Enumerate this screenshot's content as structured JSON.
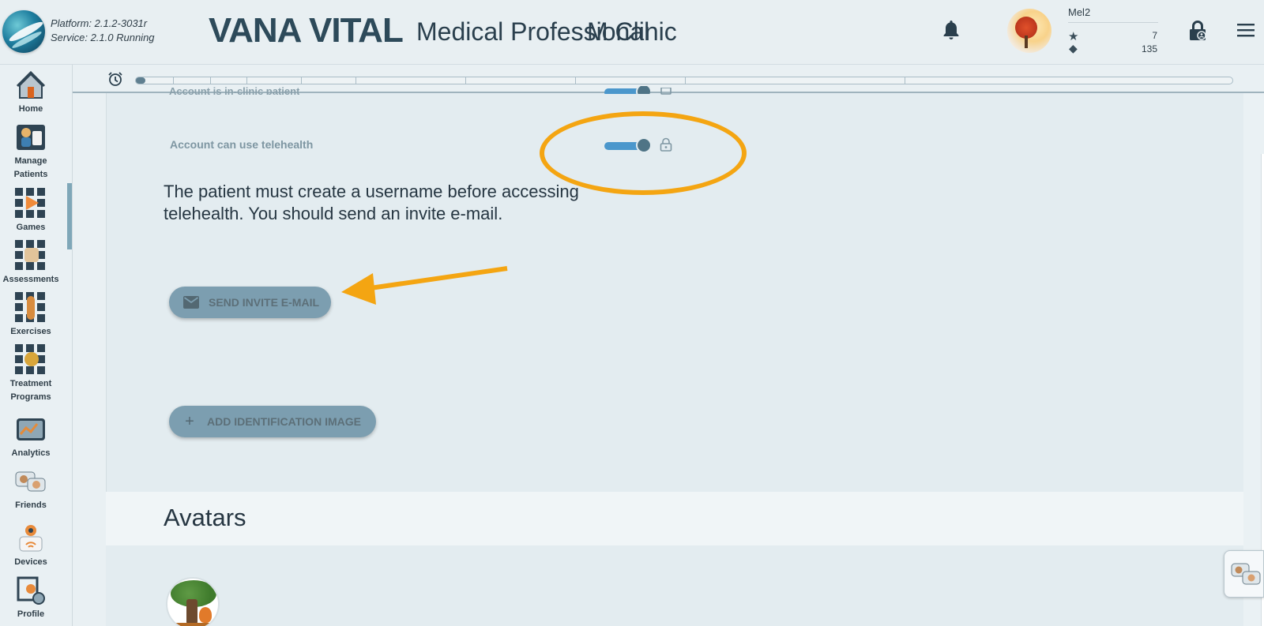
{
  "header": {
    "platform_text": "Platform: 2.1.2-3031r",
    "service_text": "Service:   2.1.0 Running",
    "brand": "VANA VITAL",
    "role": "Medical Professional",
    "clinic": "M Clinic",
    "user": {
      "name": "Mel2",
      "stars": "7",
      "gems": "135"
    }
  },
  "sidebar": {
    "items": [
      {
        "label": "Home",
        "icon": "home-icon"
      },
      {
        "label": "Manage Patients",
        "icon": "manage-patients-icon"
      },
      {
        "label": "Games",
        "icon": "games-icon"
      },
      {
        "label": "Assessments",
        "icon": "assessments-icon"
      },
      {
        "label": "Exercises",
        "icon": "exercises-icon"
      },
      {
        "label": "Treatment Programs",
        "icon": "treatment-programs-icon"
      },
      {
        "label": "Analytics",
        "icon": "analytics-icon"
      },
      {
        "label": "Friends",
        "icon": "friends-icon"
      },
      {
        "label": "Devices",
        "icon": "devices-icon"
      },
      {
        "label": "Profile",
        "icon": "profile-icon"
      }
    ]
  },
  "form": {
    "partial_label": "Account is in-clinic patient",
    "telehealth_label": "Account can use telehealth",
    "notice": "The patient must create a username before accessing telehealth. You should send an invite e-mail.",
    "send_invite_label": "SEND INVITE E-MAIL",
    "add_id_image_label": "ADD IDENTIFICATION IMAGE"
  },
  "avatars": {
    "title": "Avatars"
  },
  "colors": {
    "accent": "#4b97cc",
    "annotation": "#f4a512",
    "button": "#7c9eb0",
    "brand_text": "#2d4a5a"
  }
}
